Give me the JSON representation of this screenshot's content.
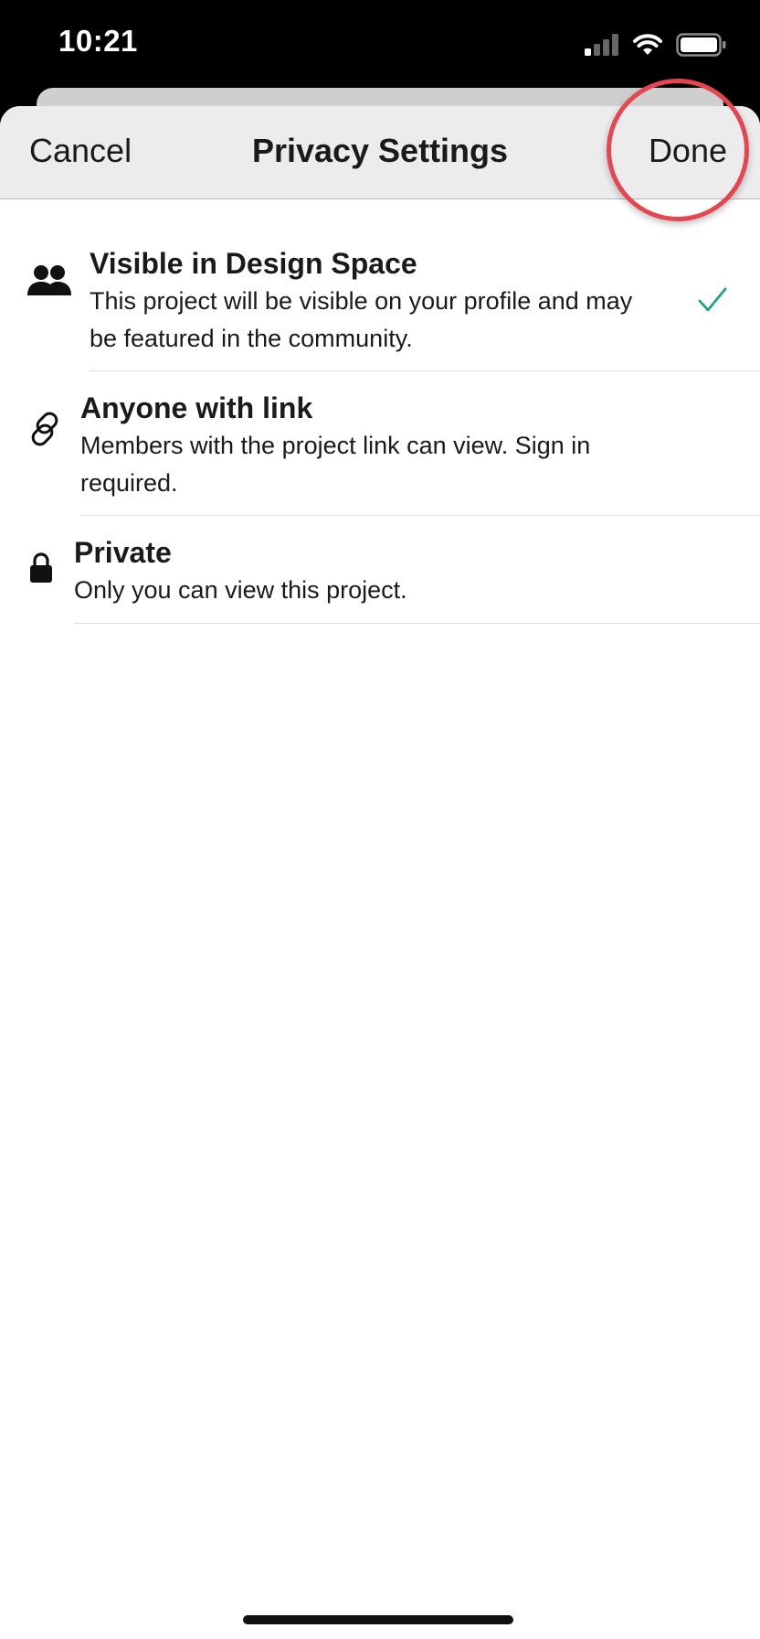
{
  "status_bar": {
    "time": "10:21"
  },
  "nav": {
    "cancel_label": "Cancel",
    "title": "Privacy Settings",
    "done_label": "Done"
  },
  "options": [
    {
      "title": "Visible in Design Space",
      "description": "This project will be visible on your profile and may be featured in the community.",
      "icon": "people-icon",
      "selected": true
    },
    {
      "title": "Anyone with link",
      "description": "Members with the project link can view. Sign in required.",
      "icon": "link-icon",
      "selected": false
    },
    {
      "title": "Private",
      "description": "Only you can view this project.",
      "icon": "lock-icon",
      "selected": false
    }
  ],
  "colors": {
    "check": "#1fa37a",
    "highlight": "#e4474f"
  }
}
